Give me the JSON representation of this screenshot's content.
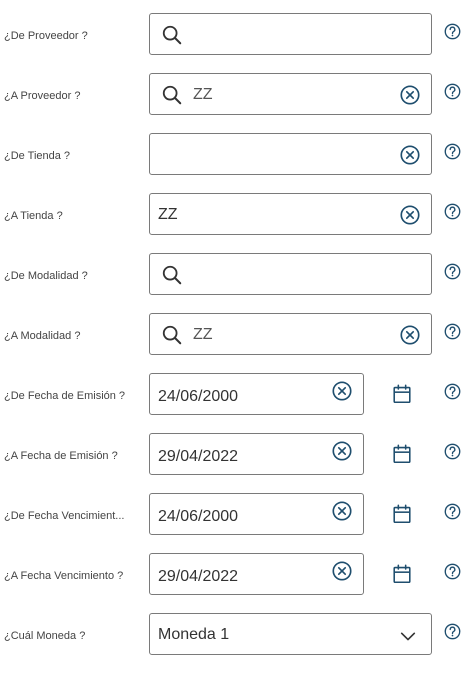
{
  "fields": [
    {
      "label": "¿De Proveedor ?",
      "value": ""
    },
    {
      "label": "¿A Proveedor ?",
      "value": "ZZ"
    },
    {
      "label": "¿De Tienda ?",
      "value": ""
    },
    {
      "label": "¿A Tienda ?",
      "value": "ZZ"
    },
    {
      "label": "¿De Modalidad ?",
      "value": ""
    },
    {
      "label": "¿A Modalidad ?",
      "value": "ZZ"
    },
    {
      "label": "¿De Fecha de Emisión ?",
      "value": "24/06/2000"
    },
    {
      "label": "¿A Fecha de Emisión ?",
      "value": "29/04/2022"
    },
    {
      "label": "¿De Fecha Vencimient...",
      "value": "24/06/2000"
    },
    {
      "label": "¿A Fecha Vencimiento ?",
      "value": "29/04/2022"
    },
    {
      "label": "¿Cuál Moneda ?",
      "value": "Moneda 1"
    }
  ],
  "colors": {
    "icon": "#1f4e6e",
    "border": "#7a7a7a",
    "text": "#333333",
    "label": "#444444"
  },
  "icons": {
    "search": "search-icon",
    "clear": "clear-icon",
    "calendar": "calendar-icon",
    "help": "help-icon",
    "dropdown": "chevron-down-icon"
  }
}
